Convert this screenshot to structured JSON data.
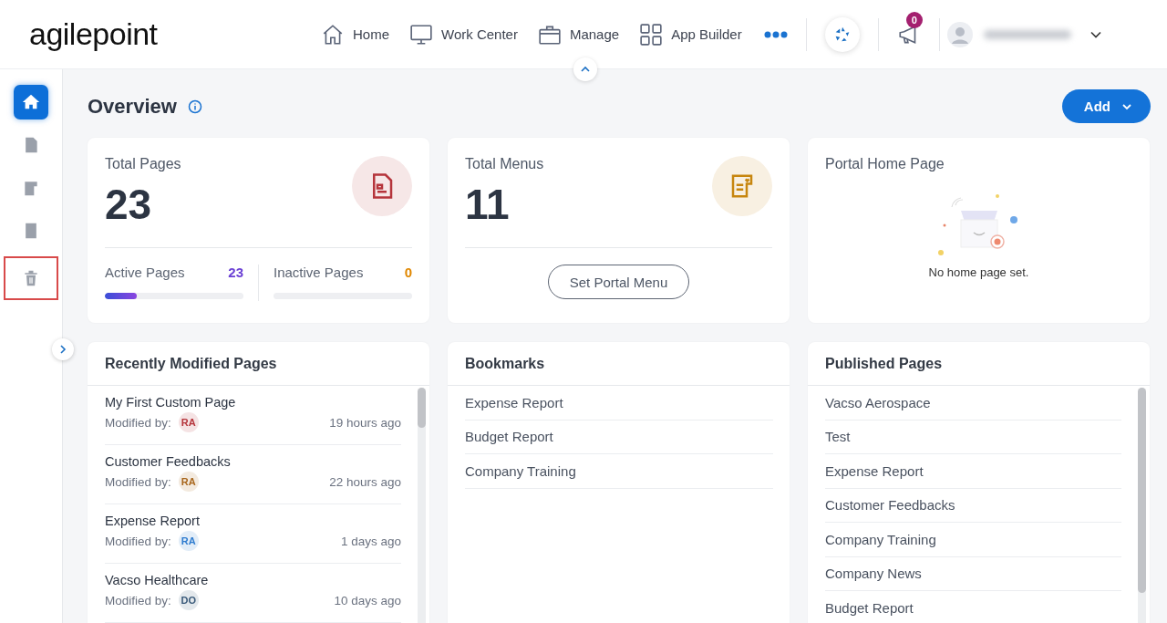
{
  "logo": "agilepoint",
  "nav": [
    {
      "label": "Home"
    },
    {
      "label": "Work Center"
    },
    {
      "label": "Manage"
    },
    {
      "label": "App Builder"
    }
  ],
  "notifications": {
    "count": "0"
  },
  "sidebar": [
    {
      "selected": true,
      "highlighted": false
    },
    {
      "selected": false,
      "highlighted": false
    },
    {
      "selected": false,
      "highlighted": false
    },
    {
      "selected": false,
      "highlighted": false
    },
    {
      "selected": false,
      "highlighted": true
    }
  ],
  "title": "Overview",
  "add_button": "Add",
  "total_pages": {
    "title": "Total Pages",
    "value": "23",
    "color": "#b5343b",
    "stats": [
      {
        "label": "Active Pages",
        "value": "23",
        "color": "#6a3fd4",
        "level": 0.23
      },
      {
        "label": "Inactive Pages",
        "value": "0",
        "color": "#e08700",
        "level": 0
      }
    ]
  },
  "total_menus": {
    "title": "Total Menus",
    "value": "11",
    "color": "#c7860f",
    "button": "Set Portal Menu"
  },
  "portal_home": {
    "title": "Portal Home Page",
    "empty_text": "No home page set."
  },
  "recent": {
    "title": "Recently Modified Pages",
    "rows": [
      {
        "name": "My First Custom Page",
        "by_label": "Modified by:",
        "initials": "RA",
        "color": "#b5343b",
        "time": "19 hours ago"
      },
      {
        "name": "Customer Feedbacks",
        "by_label": "Modified by:",
        "initials": "RA",
        "color": "#a8661c",
        "time": "22 hours ago"
      },
      {
        "name": "Expense Report",
        "by_label": "Modified by:",
        "initials": "RA",
        "color": "#2f7ccf",
        "time": "1 days ago"
      },
      {
        "name": "Vacso Healthcare",
        "by_label": "Modified by:",
        "initials": "DO",
        "color": "#3a5a7a",
        "time": "10 days ago"
      }
    ]
  },
  "bookmarks": {
    "title": "Bookmarks",
    "items": [
      "Expense Report",
      "Budget Report",
      "Company Training"
    ]
  },
  "published": {
    "title": "Published Pages",
    "items": [
      "Vacso Aerospace",
      "Test",
      "Expense Report",
      "Customer Feedbacks",
      "Company Training",
      "Company News",
      "Budget Report"
    ]
  }
}
